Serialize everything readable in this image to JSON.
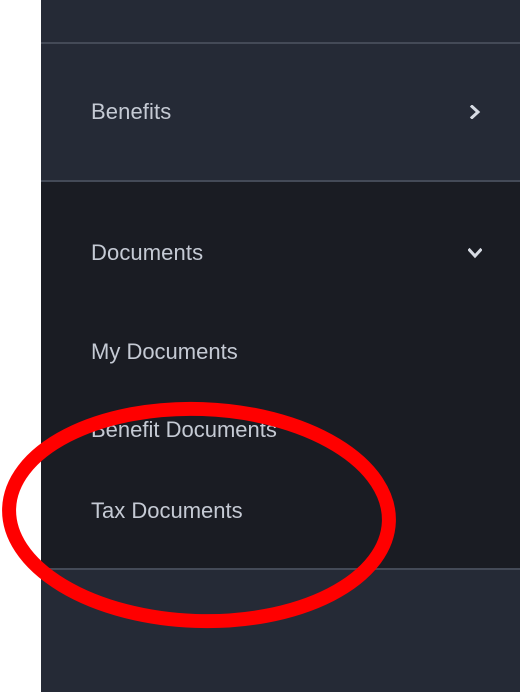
{
  "nav": {
    "benefits_label": "Benefits",
    "documents_label": "Documents",
    "documents_sub": {
      "my_documents": "My Documents",
      "benefit_documents": "Benefit Documents",
      "tax_documents": "Tax Documents"
    }
  },
  "icons": {
    "benefits_chevron": "chevron-right-icon",
    "documents_chevron": "chevron-down-icon"
  },
  "colors": {
    "sidebar_bg": "#252a36",
    "expanded_bg": "#1a1c23",
    "text": "#c5cad4",
    "annotation": "#ff0000"
  }
}
